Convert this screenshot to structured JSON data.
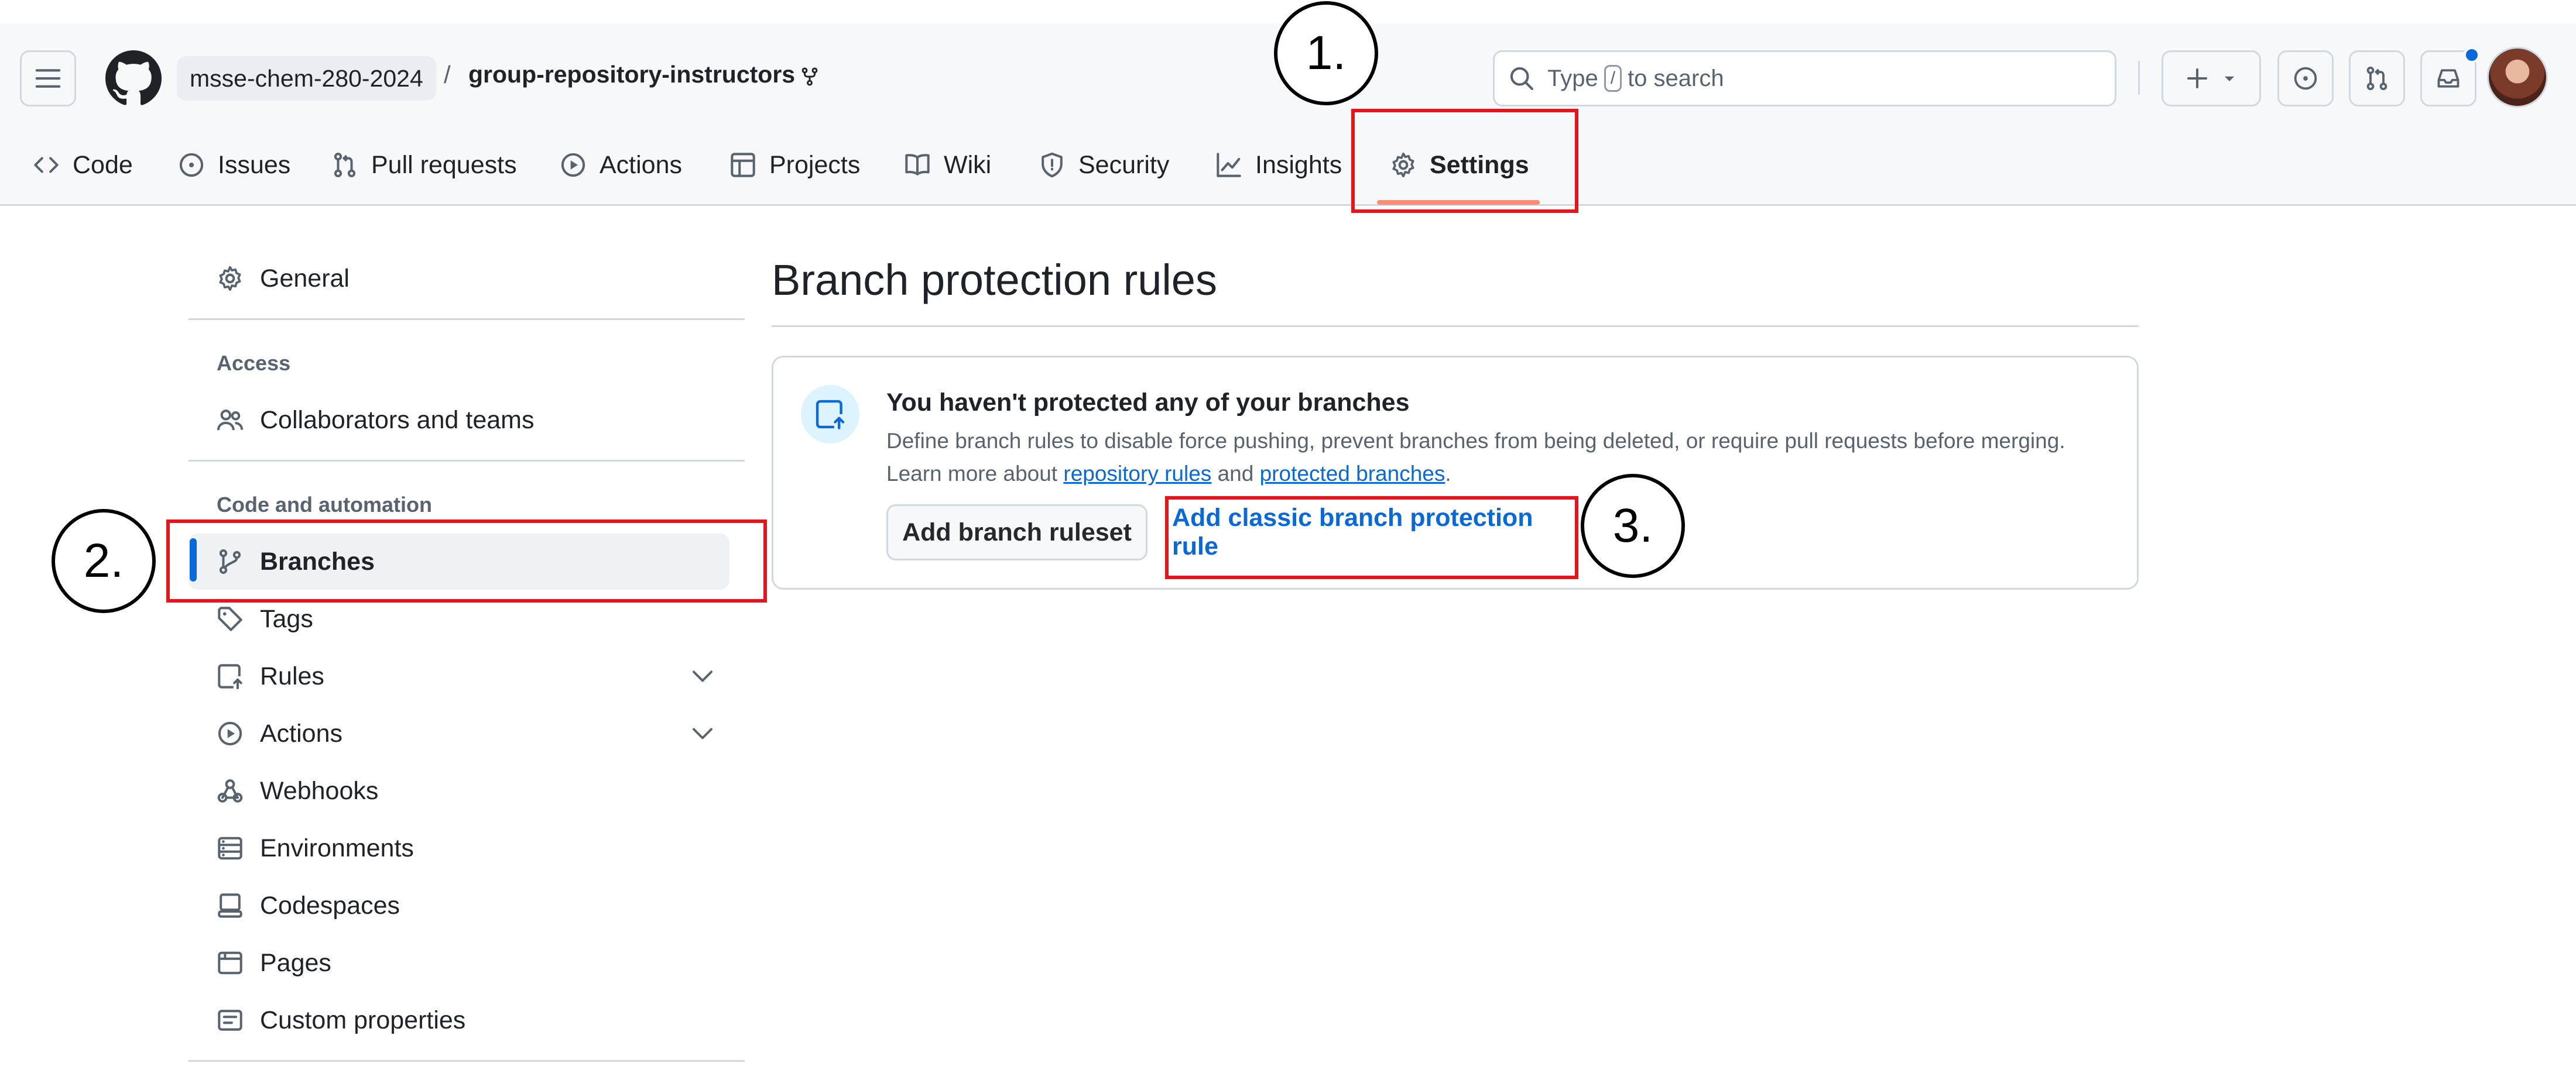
{
  "header": {
    "owner": "msse-chem-280-2024",
    "separator": "/",
    "repo": "group-repository-instructors",
    "search": {
      "prefix": "Type",
      "key": "/",
      "suffix": "to search"
    }
  },
  "tabs": [
    {
      "label": "Code",
      "icon": "code-icon"
    },
    {
      "label": "Issues",
      "icon": "issue-icon"
    },
    {
      "label": "Pull requests",
      "icon": "pull-request-icon"
    },
    {
      "label": "Actions",
      "icon": "play-icon"
    },
    {
      "label": "Projects",
      "icon": "table-icon"
    },
    {
      "label": "Wiki",
      "icon": "book-icon"
    },
    {
      "label": "Security",
      "icon": "shield-icon"
    },
    {
      "label": "Insights",
      "icon": "graph-icon"
    },
    {
      "label": "Settings",
      "icon": "gear-icon",
      "selected": true
    }
  ],
  "sidebar": {
    "general": "General",
    "access_heading": "Access",
    "collaborators": "Collaborators and teams",
    "code_heading": "Code and automation",
    "items": [
      {
        "label": "Branches",
        "icon": "git-branch-icon",
        "active": true
      },
      {
        "label": "Tags",
        "icon": "tag-icon"
      },
      {
        "label": "Rules",
        "icon": "rules-icon",
        "expandable": true
      },
      {
        "label": "Actions",
        "icon": "play-icon",
        "expandable": true
      },
      {
        "label": "Webhooks",
        "icon": "webhook-icon"
      },
      {
        "label": "Environments",
        "icon": "server-icon"
      },
      {
        "label": "Codespaces",
        "icon": "codespaces-icon"
      },
      {
        "label": "Pages",
        "icon": "browser-icon"
      },
      {
        "label": "Custom properties",
        "icon": "note-icon"
      }
    ]
  },
  "main": {
    "title": "Branch protection rules",
    "blank_heading": "You haven't protected any of your branches",
    "blank_desc_line1": "Define branch rules to disable force pushing, prevent branches from being deleted, or require pull requests before merging.",
    "learn_more": "Learn more about",
    "link_repository_rules": "repository rules",
    "and": "and",
    "link_protected_branches": "protected branches",
    "period": ".",
    "add_ruleset_button": "Add branch ruleset",
    "add_classic_button": "Add classic branch protection rule"
  },
  "annotations": {
    "step1": "1.",
    "step2": "2.",
    "step3": "3.",
    "highlight_color": "#e8141b"
  },
  "colors": {
    "accent": "#0969da",
    "tab_underline": "#fd8c73"
  }
}
